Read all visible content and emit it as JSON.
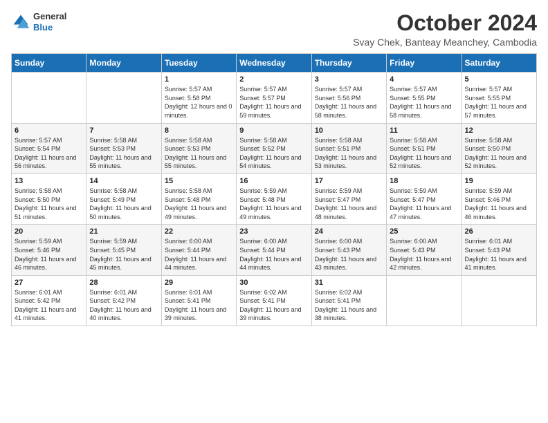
{
  "logo": {
    "general": "General",
    "blue": "Blue"
  },
  "header": {
    "month": "October 2024",
    "location": "Svay Chek, Banteay Meanchey, Cambodia"
  },
  "weekdays": [
    "Sunday",
    "Monday",
    "Tuesday",
    "Wednesday",
    "Thursday",
    "Friday",
    "Saturday"
  ],
  "weeks": [
    [
      {
        "day": "",
        "sunrise": "",
        "sunset": "",
        "daylight": ""
      },
      {
        "day": "",
        "sunrise": "",
        "sunset": "",
        "daylight": ""
      },
      {
        "day": "1",
        "sunrise": "Sunrise: 5:57 AM",
        "sunset": "Sunset: 5:58 PM",
        "daylight": "Daylight: 12 hours and 0 minutes."
      },
      {
        "day": "2",
        "sunrise": "Sunrise: 5:57 AM",
        "sunset": "Sunset: 5:57 PM",
        "daylight": "Daylight: 11 hours and 59 minutes."
      },
      {
        "day": "3",
        "sunrise": "Sunrise: 5:57 AM",
        "sunset": "Sunset: 5:56 PM",
        "daylight": "Daylight: 11 hours and 58 minutes."
      },
      {
        "day": "4",
        "sunrise": "Sunrise: 5:57 AM",
        "sunset": "Sunset: 5:55 PM",
        "daylight": "Daylight: 11 hours and 58 minutes."
      },
      {
        "day": "5",
        "sunrise": "Sunrise: 5:57 AM",
        "sunset": "Sunset: 5:55 PM",
        "daylight": "Daylight: 11 hours and 57 minutes."
      }
    ],
    [
      {
        "day": "6",
        "sunrise": "Sunrise: 5:57 AM",
        "sunset": "Sunset: 5:54 PM",
        "daylight": "Daylight: 11 hours and 56 minutes."
      },
      {
        "day": "7",
        "sunrise": "Sunrise: 5:58 AM",
        "sunset": "Sunset: 5:53 PM",
        "daylight": "Daylight: 11 hours and 55 minutes."
      },
      {
        "day": "8",
        "sunrise": "Sunrise: 5:58 AM",
        "sunset": "Sunset: 5:53 PM",
        "daylight": "Daylight: 11 hours and 55 minutes."
      },
      {
        "day": "9",
        "sunrise": "Sunrise: 5:58 AM",
        "sunset": "Sunset: 5:52 PM",
        "daylight": "Daylight: 11 hours and 54 minutes."
      },
      {
        "day": "10",
        "sunrise": "Sunrise: 5:58 AM",
        "sunset": "Sunset: 5:51 PM",
        "daylight": "Daylight: 11 hours and 53 minutes."
      },
      {
        "day": "11",
        "sunrise": "Sunrise: 5:58 AM",
        "sunset": "Sunset: 5:51 PM",
        "daylight": "Daylight: 11 hours and 52 minutes."
      },
      {
        "day": "12",
        "sunrise": "Sunrise: 5:58 AM",
        "sunset": "Sunset: 5:50 PM",
        "daylight": "Daylight: 11 hours and 52 minutes."
      }
    ],
    [
      {
        "day": "13",
        "sunrise": "Sunrise: 5:58 AM",
        "sunset": "Sunset: 5:50 PM",
        "daylight": "Daylight: 11 hours and 51 minutes."
      },
      {
        "day": "14",
        "sunrise": "Sunrise: 5:58 AM",
        "sunset": "Sunset: 5:49 PM",
        "daylight": "Daylight: 11 hours and 50 minutes."
      },
      {
        "day": "15",
        "sunrise": "Sunrise: 5:58 AM",
        "sunset": "Sunset: 5:48 PM",
        "daylight": "Daylight: 11 hours and 49 minutes."
      },
      {
        "day": "16",
        "sunrise": "Sunrise: 5:59 AM",
        "sunset": "Sunset: 5:48 PM",
        "daylight": "Daylight: 11 hours and 49 minutes."
      },
      {
        "day": "17",
        "sunrise": "Sunrise: 5:59 AM",
        "sunset": "Sunset: 5:47 PM",
        "daylight": "Daylight: 11 hours and 48 minutes."
      },
      {
        "day": "18",
        "sunrise": "Sunrise: 5:59 AM",
        "sunset": "Sunset: 5:47 PM",
        "daylight": "Daylight: 11 hours and 47 minutes."
      },
      {
        "day": "19",
        "sunrise": "Sunrise: 5:59 AM",
        "sunset": "Sunset: 5:46 PM",
        "daylight": "Daylight: 11 hours and 46 minutes."
      }
    ],
    [
      {
        "day": "20",
        "sunrise": "Sunrise: 5:59 AM",
        "sunset": "Sunset: 5:46 PM",
        "daylight": "Daylight: 11 hours and 46 minutes."
      },
      {
        "day": "21",
        "sunrise": "Sunrise: 5:59 AM",
        "sunset": "Sunset: 5:45 PM",
        "daylight": "Daylight: 11 hours and 45 minutes."
      },
      {
        "day": "22",
        "sunrise": "Sunrise: 6:00 AM",
        "sunset": "Sunset: 5:44 PM",
        "daylight": "Daylight: 11 hours and 44 minutes."
      },
      {
        "day": "23",
        "sunrise": "Sunrise: 6:00 AM",
        "sunset": "Sunset: 5:44 PM",
        "daylight": "Daylight: 11 hours and 44 minutes."
      },
      {
        "day": "24",
        "sunrise": "Sunrise: 6:00 AM",
        "sunset": "Sunset: 5:43 PM",
        "daylight": "Daylight: 11 hours and 43 minutes."
      },
      {
        "day": "25",
        "sunrise": "Sunrise: 6:00 AM",
        "sunset": "Sunset: 5:43 PM",
        "daylight": "Daylight: 11 hours and 42 minutes."
      },
      {
        "day": "26",
        "sunrise": "Sunrise: 6:01 AM",
        "sunset": "Sunset: 5:43 PM",
        "daylight": "Daylight: 11 hours and 41 minutes."
      }
    ],
    [
      {
        "day": "27",
        "sunrise": "Sunrise: 6:01 AM",
        "sunset": "Sunset: 5:42 PM",
        "daylight": "Daylight: 11 hours and 41 minutes."
      },
      {
        "day": "28",
        "sunrise": "Sunrise: 6:01 AM",
        "sunset": "Sunset: 5:42 PM",
        "daylight": "Daylight: 11 hours and 40 minutes."
      },
      {
        "day": "29",
        "sunrise": "Sunrise: 6:01 AM",
        "sunset": "Sunset: 5:41 PM",
        "daylight": "Daylight: 11 hours and 39 minutes."
      },
      {
        "day": "30",
        "sunrise": "Sunrise: 6:02 AM",
        "sunset": "Sunset: 5:41 PM",
        "daylight": "Daylight: 11 hours and 39 minutes."
      },
      {
        "day": "31",
        "sunrise": "Sunrise: 6:02 AM",
        "sunset": "Sunset: 5:41 PM",
        "daylight": "Daylight: 11 hours and 38 minutes."
      },
      {
        "day": "",
        "sunrise": "",
        "sunset": "",
        "daylight": ""
      },
      {
        "day": "",
        "sunrise": "",
        "sunset": "",
        "daylight": ""
      }
    ]
  ]
}
